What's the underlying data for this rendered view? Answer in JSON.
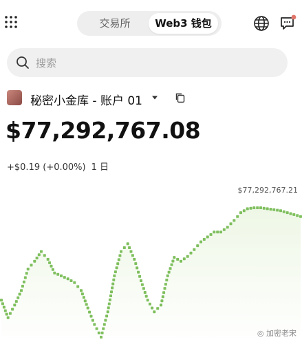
{
  "header": {
    "tabs": [
      {
        "label": "交易所",
        "active": false
      },
      {
        "label": "Web3 钱包",
        "active": true
      }
    ],
    "icons": [
      "grid-menu-icon",
      "globe-icon",
      "message-icon"
    ]
  },
  "search": {
    "placeholder": "搜索"
  },
  "account": {
    "name": "秘密小金库 - 账户 01"
  },
  "balance": {
    "amount": "$77,292,767.08",
    "change": "+$0.19 (+0.00%)",
    "period": "1 日"
  },
  "colors": {
    "accent": "#7fbf5e",
    "area_top": "#eef7e6",
    "notification": "#e0756a"
  },
  "chart_data": {
    "type": "line",
    "max_label": "$77,292,767.21",
    "x": [
      0,
      1,
      2,
      3,
      4,
      5,
      6,
      7,
      8,
      9,
      10,
      11,
      12,
      13,
      14,
      15,
      16,
      17,
      18,
      19,
      20,
      21,
      22,
      23,
      24,
      25,
      26,
      27,
      28,
      29,
      30,
      31,
      32,
      33,
      34,
      35,
      36,
      37,
      38,
      39,
      40,
      41,
      42,
      43,
      44,
      45
    ],
    "values": [
      30,
      12,
      25,
      40,
      62,
      70,
      80,
      72,
      58,
      55,
      52,
      48,
      40,
      22,
      5,
      -8,
      18,
      55,
      80,
      88,
      72,
      50,
      30,
      18,
      25,
      55,
      74,
      70,
      75,
      82,
      90,
      95,
      100,
      100,
      105,
      112,
      120,
      124,
      125,
      125,
      124,
      123,
      122,
      120,
      118,
      116
    ]
  }
}
